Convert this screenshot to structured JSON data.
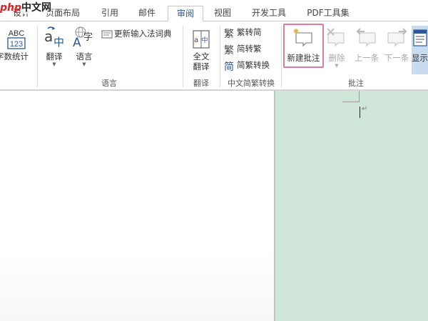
{
  "watermark": {
    "brand": "php",
    "name": "中文网"
  },
  "tabs": [
    {
      "label": "设计",
      "active": false
    },
    {
      "label": "页面布局",
      "active": false
    },
    {
      "label": "引用",
      "active": false
    },
    {
      "label": "邮件",
      "active": false
    },
    {
      "label": "审阅",
      "active": true
    },
    {
      "label": "视图",
      "active": false
    },
    {
      "label": "开发工具",
      "active": false
    },
    {
      "label": "PDF工具集",
      "active": false
    }
  ],
  "proofing": {
    "word_count_icon_text_top": "ABC",
    "word_count_icon_text_bottom": "123",
    "word_count_label": "字数统计"
  },
  "language_group": {
    "translate_label": "翻译",
    "language_label": "语言",
    "ime_dictionary_label": "更新输入法词典",
    "group_label": "语言"
  },
  "translate_group": {
    "full_text_line1": "全文",
    "full_text_line2": "翻译",
    "group_label": "翻译"
  },
  "chinese_conversion": {
    "trad_to_simp": "繁转简",
    "simp_to_trad": "简转繁",
    "conversion": "简繁转换",
    "group_label": "中文简繁转换"
  },
  "comments_group": {
    "new_comment": "新建批注",
    "delete": "删除",
    "previous": "上一条",
    "next": "下一条",
    "show": "显示",
    "group_label": "批注"
  },
  "document": {
    "paragraph_mark": "↵"
  },
  "colors": {
    "accent": "#2b579a",
    "highlight_box": "#e07aa0",
    "margin_pane": "#cfe6d9"
  }
}
